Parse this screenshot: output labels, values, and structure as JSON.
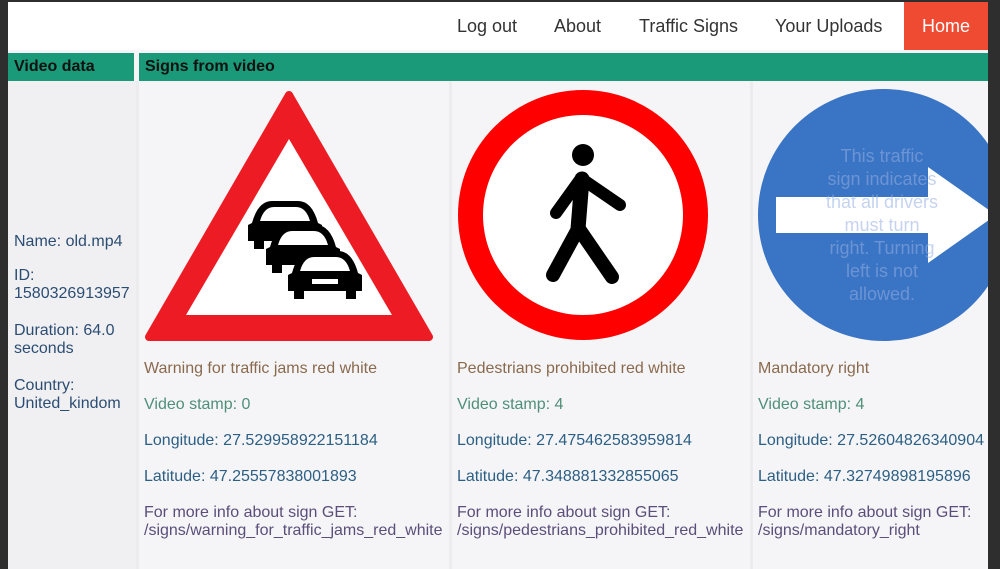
{
  "nav": {
    "items": [
      {
        "label": "Log out"
      },
      {
        "label": "About"
      },
      {
        "label": "Traffic Signs"
      },
      {
        "label": "Your Uploads"
      },
      {
        "label": "Home"
      }
    ]
  },
  "headers": {
    "video_data": "Video data",
    "signs_from_video": "Signs from video"
  },
  "video": {
    "name": "Name: old.mp4",
    "id_label": "ID:",
    "id_value": "1580326913957",
    "duration_label": "Duration: 64.0",
    "duration_unit": "seconds",
    "country_label": "Country:",
    "country_value": "United_kindom"
  },
  "signs": [
    {
      "icon": "warning-traffic-jam-sign",
      "name": "Warning for traffic jams red white",
      "stamp": "Video stamp: 0",
      "longitude": "Longitude: 27.529958922151184",
      "latitude": "Latitude: 47.25557838001893",
      "info_label": "For more info about sign GET:",
      "info_path": "/signs/warning_for_traffic_jams_red_white"
    },
    {
      "icon": "pedestrians-prohibited-sign",
      "name": "Pedestrians prohibited red white",
      "stamp": "Video stamp: 4",
      "longitude": "Longitude: 27.475462583959814",
      "latitude": "Latitude: 47.348881332855065",
      "info_label": "For more info about sign GET:",
      "info_path": "/signs/pedestrians_prohibited_red_white"
    },
    {
      "icon": "mandatory-right-sign",
      "name": "Mandatory right",
      "stamp": "Video stamp: 4",
      "longitude": "Longitude: 27.52604826340904",
      "latitude": "Latitude: 47.32749898195896",
      "info_label": "For more info about sign GET:",
      "info_path": "/signs/mandatory_right",
      "overlay_lines": [
        "This traffic",
        "sign indicates",
        "that all drivers",
        "must turn",
        "right. Turning",
        "left is not",
        "allowed."
      ]
    }
  ],
  "colors": {
    "accent": "#1a9a78",
    "nav_active": "#ef4a32",
    "sign_red": "#ed1c24",
    "sign_blue": "#3a74c4"
  }
}
